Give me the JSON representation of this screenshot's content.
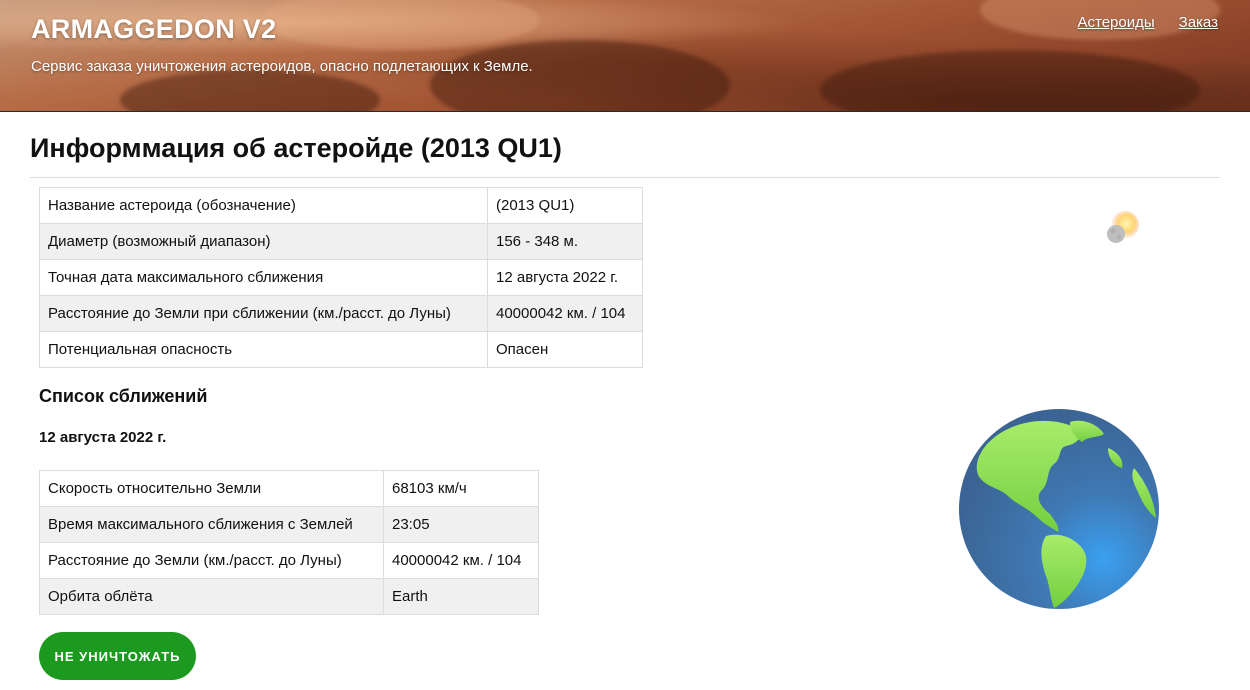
{
  "header": {
    "brand": "ARMAGGEDON V2",
    "tagline": "Сервис заказа уничтожения астероидов, опасно подлетающих к Земле.",
    "nav": [
      {
        "label": "Астероиды"
      },
      {
        "label": "Заказ"
      }
    ]
  },
  "page": {
    "title": "Информмация об астеройде (2013 QU1)"
  },
  "asteroid_info": {
    "rows": [
      {
        "label": "Название астероида (обозначение)",
        "value": "(2013 QU1)"
      },
      {
        "label": "Диаметр (возможный диапазон)",
        "value": "156 - 348 м."
      },
      {
        "label": "Точная дата максимального сближения",
        "value": "12 августа 2022 г."
      },
      {
        "label": "Расстояние до Земли при сближении (км./расст. до Луны)",
        "value": "40000042 км. / 104"
      },
      {
        "label": "Потенциальная опасность",
        "value": "Опасен"
      }
    ]
  },
  "approaches": {
    "section_title": "Список сближений",
    "date": "12 августа 2022 г.",
    "rows": [
      {
        "label": "Скорость относительно Земли",
        "value": "68103 км/ч"
      },
      {
        "label": "Время максимального сближения с Землей",
        "value": "23:05"
      },
      {
        "label": "Расстояние до Земли (км./расст. до Луны)",
        "value": "40000042 км. / 104"
      },
      {
        "label": "Орбита облёта",
        "value": "Earth"
      }
    ]
  },
  "actions": {
    "destroy_label": "НЕ УНИЧТОЖАТЬ"
  },
  "icons": {
    "asteroid": "asteroid-icon",
    "earth": "earth-icon"
  },
  "colors": {
    "button": "#1c9a1f",
    "ocean": "#3f6fa4",
    "land": "#7ed957"
  }
}
